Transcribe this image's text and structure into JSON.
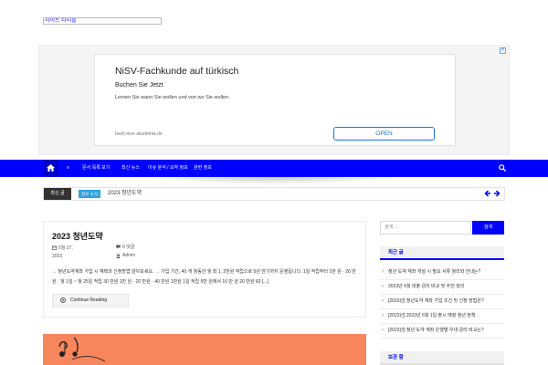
{
  "site": {
    "title": "사이트 타이틀"
  },
  "ad": {
    "close": "×",
    "title": "NiSV-Fachkunde auf türkisch",
    "subtitle": "Buchen Sie Jetzt",
    "description": "Lernen Sie wann Sie wollen und von wo Sie wollen.",
    "domain": "bash-nisv-akademie.de",
    "open_label": "OPEN"
  },
  "nav": {
    "items": [
      {
        "label": "≡"
      },
      {
        "label": "문서 목록 보기"
      },
      {
        "label": "최신 뉴스"
      },
      {
        "label": "이슈 분석 / 요약 정보"
      },
      {
        "label": "관련 정보"
      }
    ]
  },
  "ticker": {
    "label": "최신 글",
    "category": "정보 소식",
    "title": "2023 청년도약"
  },
  "post": {
    "title": "2023 청년도약",
    "date_line1": "5월 27,",
    "date_line2": "2023",
    "author": "Admin",
    "comments_line1": "0 댓글",
    "comments_line2": "의",
    "excerpt": "→ 청년도약계좌 가입 시 혜택과 신청방법 알아보세요. → 가입 기간, 40 개 월동안 월 최 1, 2만원 적립으로 5년 만기까지 운영됩니다. 1일 적립부터 1만 원 · 20 만원 · 월 1일 ~ 월 25일 적립 30 만원 1만 원 · 20 만원 · 40 만원 1만원 1일 적립 5만 원에서 10 만 원 20 만원 60 [...]",
    "continue_label": "Continue Reading"
  },
  "sidebar": {
    "search_placeholder": "검색 ...",
    "search_button": "검색",
    "recent_title": "최근 글",
    "recent": [
      "청년 도약 계좌 개설 시 필요 서류 정리와 안내는?",
      "2023년 6월 대출 금리 비교 및 추천 정리",
      "[2023년] 청년도약 계좌 가입 조건 및 신청 방법은?",
      "[2023년] 2023년 6월 1일 출시 예정 청년 정책",
      "[2023년] 청년 도약 계좌 은행별 우대 금리 비교는?"
    ],
    "archives_title": "보관 함"
  },
  "colors": {
    "brand": "#0000ff",
    "accent": "#2fa3e0",
    "image_bg": "#f8865c"
  }
}
